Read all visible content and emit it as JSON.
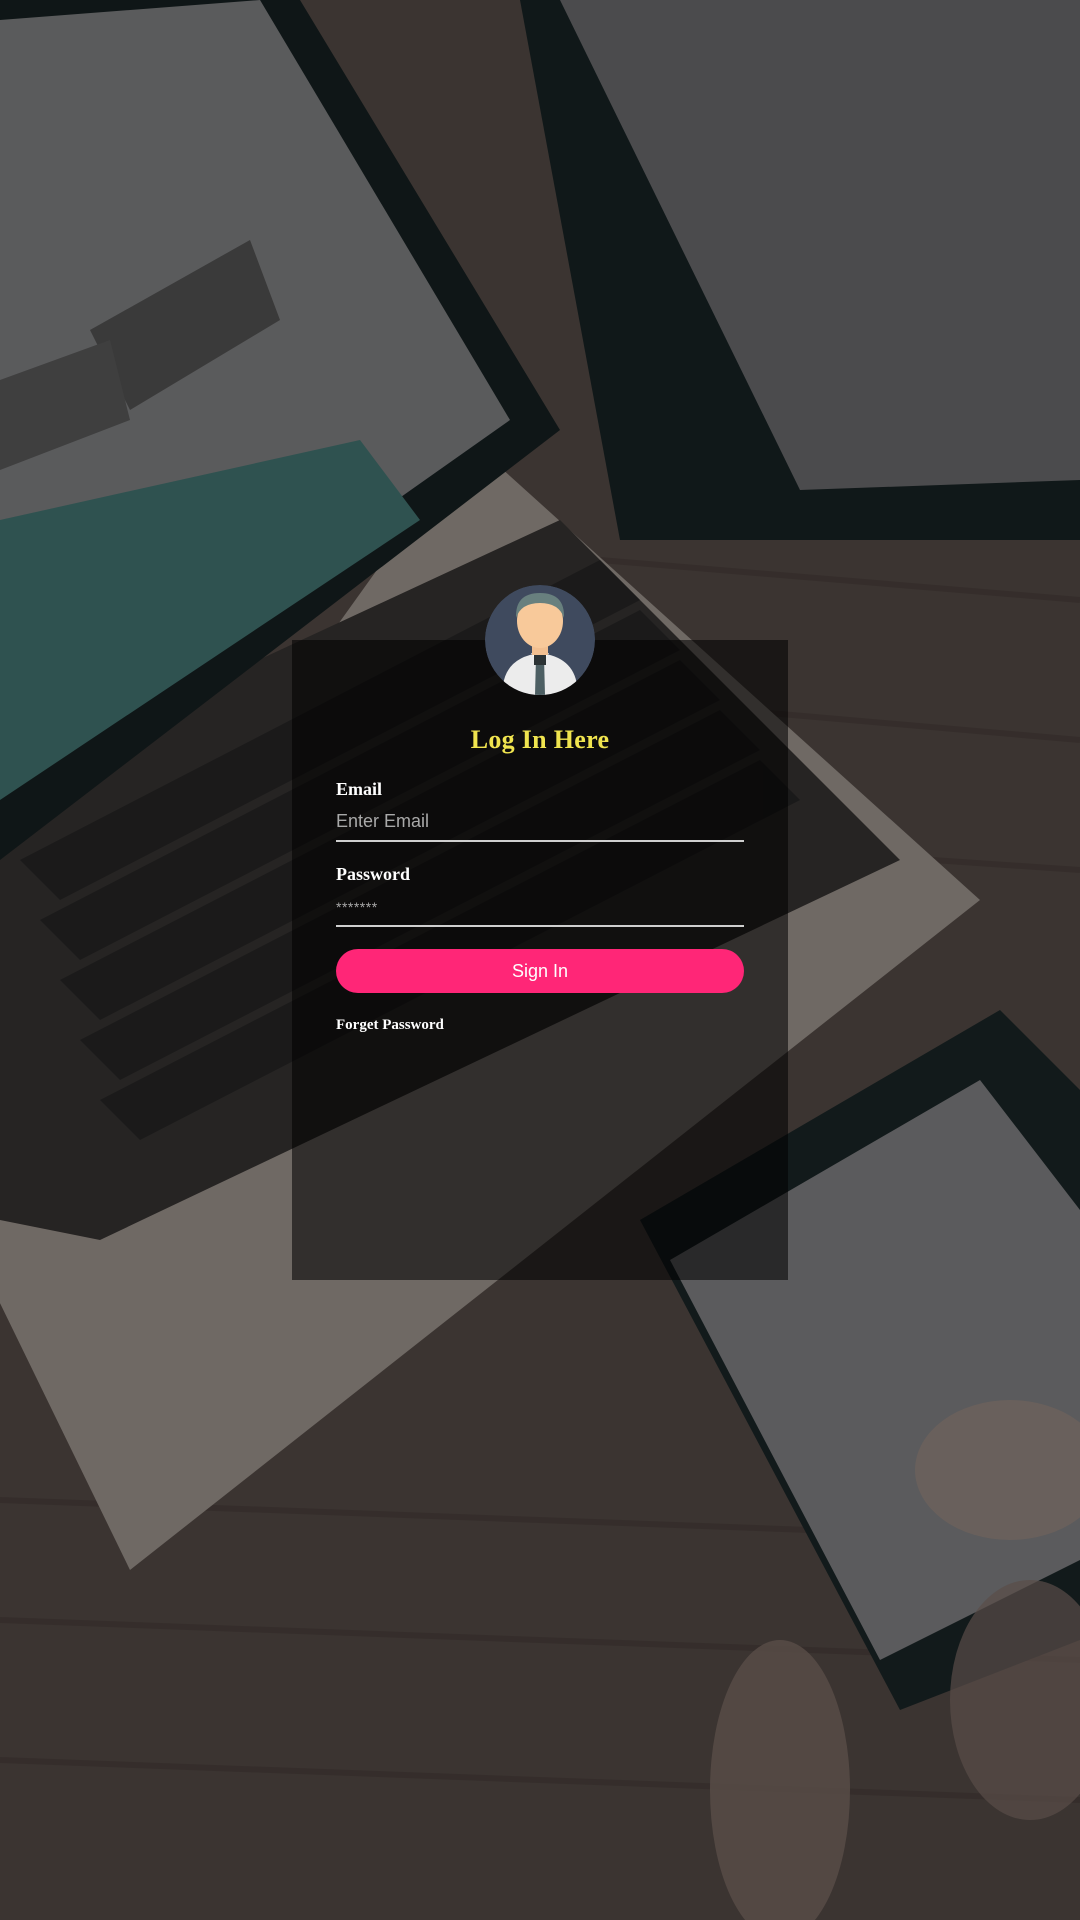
{
  "login": {
    "title": "Log In Here",
    "email_label": "Email",
    "email_placeholder": "Enter Email",
    "email_value": "",
    "password_label": "Password",
    "password_placeholder": "*******",
    "password_value": "",
    "signin_label": "Sign In",
    "forget_password_label": "Forget Password"
  },
  "colors": {
    "title": "#f0e44f",
    "button": "#ff2677",
    "panel": "rgba(0,0,0,0.55)"
  },
  "icons": {
    "avatar": "user-avatar-icon"
  }
}
